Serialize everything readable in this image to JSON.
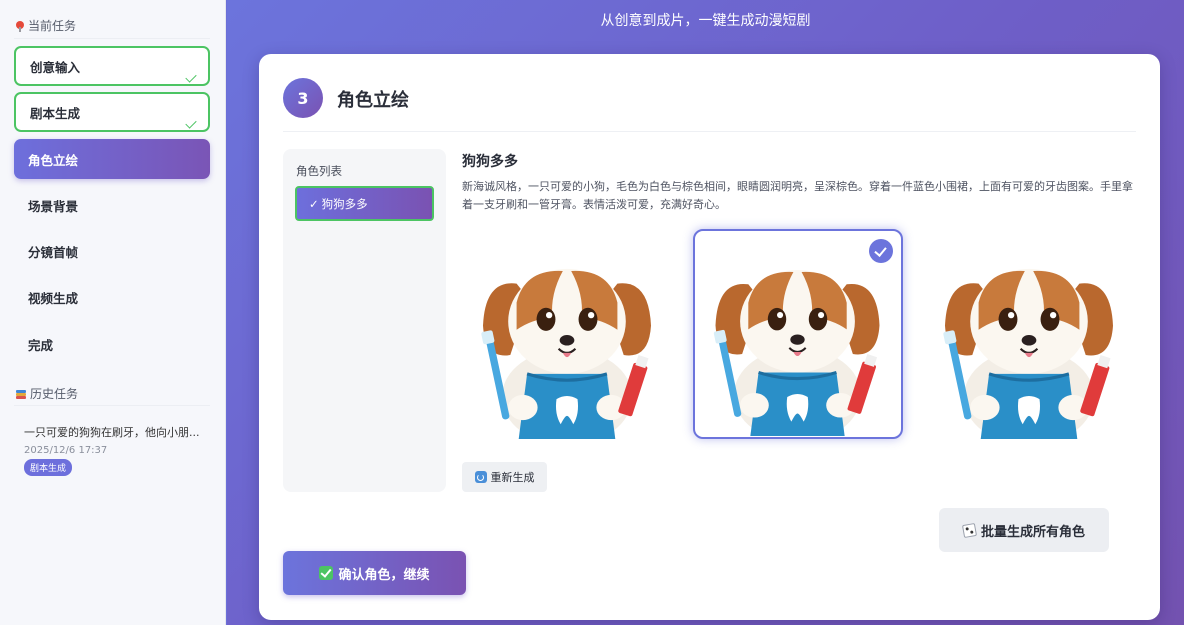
{
  "sidebar": {
    "current_section": "当前任务",
    "tasks": [
      {
        "label": "创意输入",
        "state": "done"
      },
      {
        "label": "剧本生成",
        "state": "done"
      },
      {
        "label": "角色立绘",
        "state": "active"
      },
      {
        "label": "场景背景",
        "state": "pending"
      },
      {
        "label": "分镜首帧",
        "state": "pending"
      },
      {
        "label": "视频生成",
        "state": "pending"
      },
      {
        "label": "完成",
        "state": "pending"
      }
    ],
    "history_section": "历史任务",
    "history": [
      {
        "title": "一只可爱的狗狗在刷牙，他向小朋...",
        "date": "2025/12/6 17:37",
        "badge": "剧本生成"
      }
    ]
  },
  "header": {
    "banner": "从创意到成片，一键生成动漫短剧"
  },
  "step": {
    "number": "3",
    "title": "角色立绘"
  },
  "character_list": {
    "title": "角色列表",
    "items": [
      {
        "label": "狗狗多多",
        "selected": true
      }
    ]
  },
  "character": {
    "name": "狗狗多多",
    "description": "新海诚风格，一只可爱的小狗，毛色为白色与棕色相间，眼睛圆润明亮，呈深棕色。穿着一件蓝色小围裙，上面有可爱的牙齿图案。手里拿着一支牙刷和一管牙膏。表情活泼可爱，充满好奇心。",
    "images": [
      {
        "name": "portrait-1",
        "selected": false
      },
      {
        "name": "portrait-2",
        "selected": true
      },
      {
        "name": "portrait-3",
        "selected": false
      }
    ]
  },
  "buttons": {
    "regenerate": "重新生成",
    "batch_generate": "批量生成所有角色",
    "confirm": "确认角色，继续"
  },
  "icons": {
    "current_section": "pin-icon",
    "history_section": "books-icon",
    "regenerate": "refresh-icon",
    "batch": "dice-icon",
    "confirm": "check-box-icon",
    "list_item": "checkmark-icon"
  },
  "colors": {
    "accent": "#6c74dc",
    "accent_end": "#7a52b2",
    "done_border": "#4cc463",
    "apron": "#2a8fc8"
  }
}
